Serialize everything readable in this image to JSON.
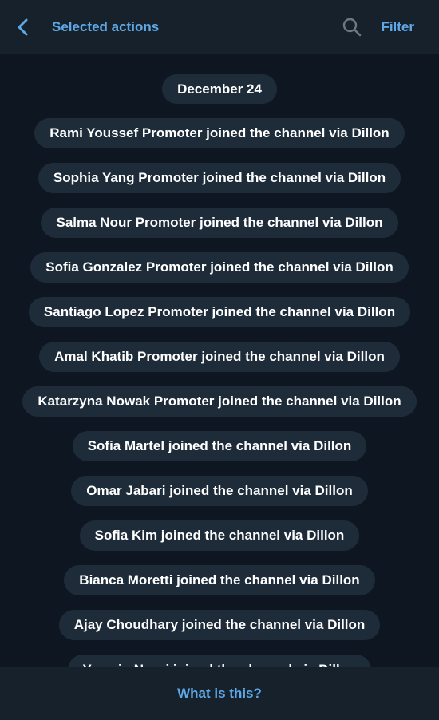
{
  "header": {
    "title": "Selected actions",
    "filter_label": "Filter",
    "back_icon": "chevron-left-icon",
    "search_icon": "search-icon"
  },
  "log": {
    "date": "December 24",
    "events": [
      "Rami Youssef Promoter joined the channel via Dillon",
      "Sophia Yang Promoter joined the channel via Dillon",
      "Salma Nour Promoter joined the channel via Dillon",
      "Sofia Gonzalez Promoter joined the channel via Dillon",
      "Santiago Lopez Promoter joined the channel via Dillon",
      "Amal Khatib Promoter joined the channel via Dillon",
      "Katarzyna Nowak Promoter joined the channel via Dillon",
      "Sofia Martel joined the channel via Dillon",
      "Omar Jabari joined the channel via Dillon",
      "Sofia Kim joined the channel via Dillon",
      "Bianca Moretti joined the channel via Dillon",
      "Ajay Choudhary joined the channel via Dillon",
      "Yasmin Noori joined the channel via Dillon"
    ]
  },
  "footer": {
    "label": "What is this?"
  },
  "colors": {
    "background": "#0e1621",
    "bar": "#17212b",
    "pill": "#1e2c3a",
    "accent": "#5ea8e8",
    "text": "#ffffff"
  }
}
